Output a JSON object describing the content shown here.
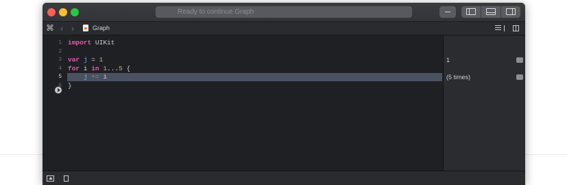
{
  "window": {
    "activity_status": "Ready to continue Graph"
  },
  "jump_bar": {
    "file_name": "Graph"
  },
  "editor": {
    "lines": [
      {
        "number": "1",
        "tokens": [
          [
            "k",
            "import"
          ],
          [
            "t",
            " UIKit"
          ]
        ]
      },
      {
        "number": "2",
        "tokens": []
      },
      {
        "number": "3",
        "tokens": [
          [
            "k",
            "var"
          ],
          [
            "t",
            " "
          ],
          [
            "v",
            "j"
          ],
          [
            "t",
            " = "
          ],
          [
            "n",
            "1"
          ]
        ]
      },
      {
        "number": "4",
        "tokens": [
          [
            "k",
            "for"
          ],
          [
            "t",
            " i "
          ],
          [
            "k",
            "in"
          ],
          [
            "t",
            " "
          ],
          [
            "n",
            "1"
          ],
          [
            "t",
            "..."
          ],
          [
            "n",
            "5"
          ],
          [
            "t",
            " {"
          ]
        ]
      },
      {
        "number": "5",
        "tokens": [
          [
            "t",
            "    "
          ],
          [
            "v",
            "j"
          ],
          [
            "t",
            " "
          ],
          [
            "dim",
            "+="
          ],
          [
            "t",
            " i"
          ]
        ],
        "current": true
      },
      {
        "number": "6",
        "tokens": [
          [
            "t",
            "}"
          ]
        ]
      }
    ]
  },
  "results": [
    {
      "text": "1",
      "line": 3
    },
    {
      "text": "(5 times)",
      "line": 5
    }
  ],
  "colors": {
    "keyword": "#e55eae",
    "variable": "#6fb2e8",
    "number": "#c9b670",
    "current_line_highlight": "#4a5261",
    "editor_background": "#1f2024"
  },
  "icons": {
    "traffic_lights": [
      "close-icon",
      "minimize-icon",
      "zoom-icon"
    ],
    "toolbar": [
      "minus-icon",
      "left-panel-icon",
      "bottom-panel-icon",
      "right-panel-icon"
    ],
    "jump_bar": [
      "grid-icon",
      "back-icon",
      "forward-icon",
      "playground-file-icon",
      "lines-icon",
      "split-editor-icon"
    ],
    "bottom_bar": [
      "debug-area-icon",
      "stop-icon"
    ],
    "gutter": [
      "run-icon"
    ]
  }
}
